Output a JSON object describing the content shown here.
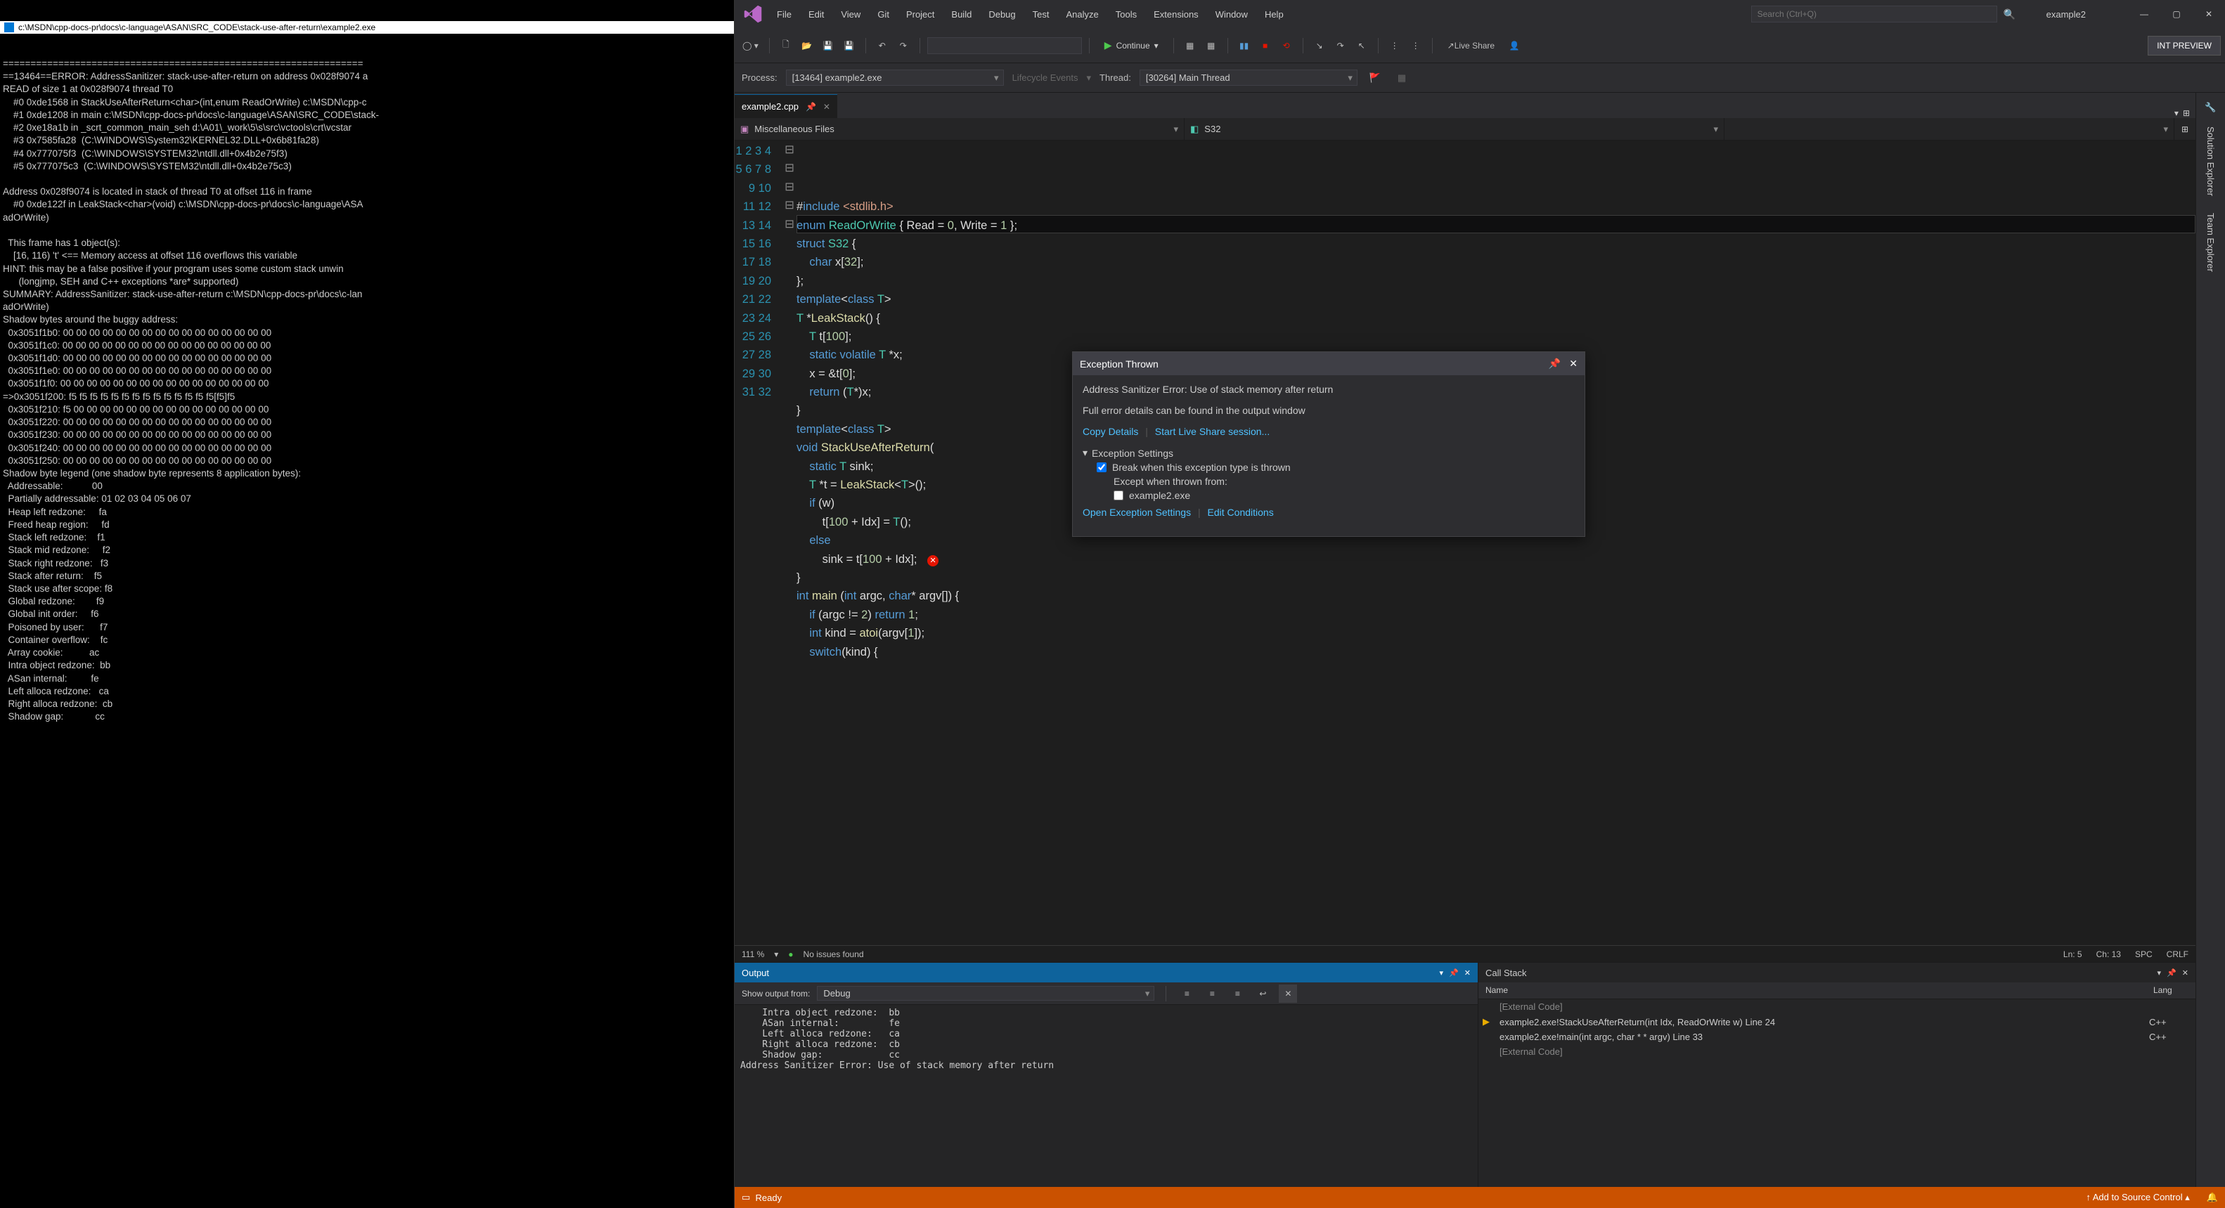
{
  "console": {
    "title": "c:\\MSDN\\cpp-docs-pr\\docs\\c-language\\ASAN\\SRC_CODE\\stack-use-after-return\\example2.exe",
    "body": "=================================================================\n==13464==ERROR: AddressSanitizer: stack-use-after-return on address 0x028f9074 a\nREAD of size 1 at 0x028f9074 thread T0\n    #0 0xde1568 in StackUseAfterReturn<char>(int,enum ReadOrWrite) c:\\MSDN\\cpp-c\n    #1 0xde1208 in main c:\\MSDN\\cpp-docs-pr\\docs\\c-language\\ASAN\\SRC_CODE\\stack-\n    #2 0xe18a1b in _scrt_common_main_seh d:\\A01\\_work\\5\\s\\src\\vctools\\crt\\vcstar\n    #3 0x7585fa28  (C:\\WINDOWS\\System32\\KERNEL32.DLL+0x6b81fa28)\n    #4 0x777075f3  (C:\\WINDOWS\\SYSTEM32\\ntdll.dll+0x4b2e75f3)\n    #5 0x777075c3  (C:\\WINDOWS\\SYSTEM32\\ntdll.dll+0x4b2e75c3)\n\nAddress 0x028f9074 is located in stack of thread T0 at offset 116 in frame\n    #0 0xde122f in LeakStack<char>(void) c:\\MSDN\\cpp-docs-pr\\docs\\c-language\\ASA\nadOrWrite)\n\n  This frame has 1 object(s):\n    [16, 116) 't' <== Memory access at offset 116 overflows this variable\nHINT: this may be a false positive if your program uses some custom stack unwin\n      (longjmp, SEH and C++ exceptions *are* supported)\nSUMMARY: AddressSanitizer: stack-use-after-return c:\\MSDN\\cpp-docs-pr\\docs\\c-lan\nadOrWrite)\nShadow bytes around the buggy address:\n  0x3051f1b0: 00 00 00 00 00 00 00 00 00 00 00 00 00 00 00 00\n  0x3051f1c0: 00 00 00 00 00 00 00 00 00 00 00 00 00 00 00 00\n  0x3051f1d0: 00 00 00 00 00 00 00 00 00 00 00 00 00 00 00 00\n  0x3051f1e0: 00 00 00 00 00 00 00 00 00 00 00 00 00 00 00 00\n  0x3051f1f0: 00 00 00 00 00 00 00 00 00 00 00 00 00 00 00 00\n=>0x3051f200: f5 f5 f5 f5 f5 f5 f5 f5 f5 f5 f5 f5 f5 f5[f5]f5\n  0x3051f210: f5 00 00 00 00 00 00 00 00 00 00 00 00 00 00 00\n  0x3051f220: 00 00 00 00 00 00 00 00 00 00 00 00 00 00 00 00\n  0x3051f230: 00 00 00 00 00 00 00 00 00 00 00 00 00 00 00 00\n  0x3051f240: 00 00 00 00 00 00 00 00 00 00 00 00 00 00 00 00\n  0x3051f250: 00 00 00 00 00 00 00 00 00 00 00 00 00 00 00 00\nShadow byte legend (one shadow byte represents 8 application bytes):\n  Addressable:           00\n  Partially addressable: 01 02 03 04 05 06 07\n  Heap left redzone:     fa\n  Freed heap region:     fd\n  Stack left redzone:    f1\n  Stack mid redzone:     f2\n  Stack right redzone:   f3\n  Stack after return:    f5\n  Stack use after scope: f8\n  Global redzone:        f9\n  Global init order:     f6\n  Poisoned by user:      f7\n  Container overflow:    fc\n  Array cookie:          ac\n  Intra object redzone:  bb\n  ASan internal:         fe\n  Left alloca redzone:   ca\n  Right alloca redzone:  cb\n  Shadow gap:            cc"
  },
  "menu": [
    "File",
    "Edit",
    "View",
    "Git",
    "Project",
    "Build",
    "Debug",
    "Test",
    "Analyze",
    "Tools",
    "Extensions",
    "Window",
    "Help"
  ],
  "search_placeholder": "Search (Ctrl+Q)",
  "solution_name": "example2",
  "toolbar": {
    "continue_label": "Continue",
    "liveshare_label": "Live Share",
    "preview_badge": "INT PREVIEW"
  },
  "debugbar": {
    "process_label": "Process:",
    "process_value": "[13464] example2.exe",
    "lifecycle_label": "Lifecycle Events",
    "thread_label": "Thread:",
    "thread_value": "[30264] Main Thread"
  },
  "file_tab": {
    "name": "example2.cpp"
  },
  "nav": {
    "scope": "Miscellaneous Files",
    "type": "S32"
  },
  "rightstrip": [
    "Solution Explorer",
    "Team Explorer"
  ],
  "code_lines": [
    "#include <stdlib.h>",
    "",
    "enum ReadOrWrite { Read = 0, Write = 1 };",
    "",
    "struct S32 {",
    "    char x[32];",
    "};",
    "",
    "template<class T>",
    "T *LeakStack() {",
    "    T t[100];",
    "    static volatile T *x;",
    "    x = &t[0];",
    "    return (T*)x;",
    "}",
    "",
    "template<class T>",
    "void StackUseAfterReturn(",
    "    static T sink;",
    "    T *t = LeakStack<T>();",
    "    if (w)",
    "        t[100 + Idx] = T();",
    "    else",
    "        sink = t[100 + Idx];",
    "}",
    "",
    "int main (int argc, char* argv[]) {",
    "",
    "    if (argc != 2) return 1;",
    "    int kind = atoi(argv[1]);",
    "",
    "    switch(kind) {"
  ],
  "exception": {
    "title": "Exception Thrown",
    "message": "Address Sanitizer Error: Use of stack memory after return",
    "detail": "Full error details can be found in the output window",
    "copy": "Copy Details",
    "liveshare": "Start Live Share session...",
    "settings_label": "Exception Settings",
    "break_label": "Break when this exception type is thrown",
    "except_label": "Except when thrown from:",
    "module": "example2.exe",
    "open_settings": "Open Exception Settings",
    "edit_cond": "Edit Conditions"
  },
  "editor_status": {
    "zoom": "111 %",
    "issues": "No issues found",
    "ln": "Ln: 5",
    "ch": "Ch: 13",
    "spc": "SPC",
    "crlf": "CRLF"
  },
  "output": {
    "title": "Output",
    "show_label": "Show output from:",
    "source": "Debug",
    "body": "    Intra object redzone:  bb\n    ASan internal:         fe\n    Left alloca redzone:   ca\n    Right alloca redzone:  cb\n    Shadow gap:            cc\nAddress Sanitizer Error: Use of stack memory after return"
  },
  "callstack": {
    "title": "Call Stack",
    "col_name": "Name",
    "col_lang": "Lang",
    "rows": [
      {
        "ptr": "",
        "name": "[External Code]",
        "lang": "",
        "ext": true
      },
      {
        "ptr": "▶",
        "name": "example2.exe!StackUseAfterReturn<char>(int Idx, ReadOrWrite w) Line 24",
        "lang": "C++",
        "ext": false
      },
      {
        "ptr": "",
        "name": "example2.exe!main(int argc, char * * argv) Line 33",
        "lang": "C++",
        "ext": false
      },
      {
        "ptr": "",
        "name": "[External Code]",
        "lang": "",
        "ext": true
      }
    ]
  },
  "statusbar": {
    "ready": "Ready",
    "add_source": "Add to Source Control"
  }
}
